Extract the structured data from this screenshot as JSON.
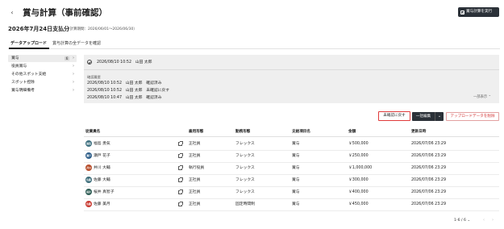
{
  "header": {
    "back_icon": "chevron-left-icon",
    "title": "賞与計算（事前確認）",
    "execute_button": "賞与計算を実行",
    "execute_icon": "checkbox-icon"
  },
  "payment": {
    "title": "2026年7月24日支払分",
    "period": "（計算期間：2026/06/01〜2026/06/30）"
  },
  "tabs": [
    {
      "label": "データアップロード",
      "active": true
    },
    {
      "label": "賞与計算の全データを確認",
      "active": false
    }
  ],
  "sidebar": {
    "items": [
      {
        "label": "賞与",
        "count": "6",
        "active": true
      },
      {
        "label": "役員賞与",
        "count": "",
        "active": false
      },
      {
        "label": "その他スポット支給",
        "count": "",
        "active": false
      },
      {
        "label": "スポット控除",
        "count": "",
        "active": false
      },
      {
        "label": "賞与明細備考",
        "count": "",
        "active": false
      }
    ]
  },
  "status": {
    "current": "2026/08/10 10:52　山田 太郎",
    "history_title": "確認履歴",
    "history": [
      "2026/08/10 10:52　山田 太郎　確認済み",
      "2026/08/10 10:52　山田 太郎　未確認に戻す",
      "2026/08/10 10:47　山田 太郎　確認済み"
    ],
    "collapse_label": "一部表示 ⌃"
  },
  "actions": {
    "unconfirm": "未確認に戻す",
    "bulk_edit": "一括編集",
    "delete_upload": "アップロードデータを削除"
  },
  "table": {
    "headers": [
      "従業員名",
      "雇用形態",
      "勤務形態",
      "支給項目名",
      "金額",
      "更新日時"
    ],
    "rows": [
      {
        "avatar": "福島",
        "avatar_color": "#3b6e7e",
        "name": "福島 勇気",
        "employment": "正社員",
        "work": "フレックス",
        "item": "賞与",
        "amount": "￥500,000",
        "updated": "2026/07/06 23:29"
      },
      {
        "avatar": "瀬戸",
        "avatar_color": "#2f5f8a",
        "name": "瀬戸 花子",
        "employment": "正社員",
        "work": "フレックス",
        "item": "賞与",
        "amount": "￥250,000",
        "updated": "2026/07/06 23:29"
      },
      {
        "avatar": "井川",
        "avatar_color": "#b8502e",
        "name": "井川 大輔",
        "employment": "執行役員",
        "work": "フレックス",
        "item": "賞与",
        "amount": "￥1,000,000",
        "updated": "2026/07/06 23:29"
      },
      {
        "avatar": "佐藤",
        "avatar_color": "#3a6b78",
        "name": "佐藤 大輔",
        "employment": "正社員",
        "work": "フレックス",
        "item": "賞与",
        "amount": "￥300,000",
        "updated": "2026/07/06 23:29"
      },
      {
        "avatar": "桜井",
        "avatar_color": "#2e5c54",
        "name": "桜井 真智子",
        "employment": "正社員",
        "work": "フレックス",
        "item": "賞与",
        "amount": "￥400,000",
        "updated": "2026/07/06 23:29"
      },
      {
        "avatar": "佐藤",
        "avatar_color": "#c9382f",
        "name": "佐藤 美月",
        "employment": "正社員",
        "work": "固定時間制",
        "item": "賞与",
        "amount": "￥450,000",
        "updated": "2026/07/06 23:29"
      }
    ]
  },
  "pagination": {
    "label": "1-6 / 6 ⌄",
    "prev_icon": "chevron-left-icon",
    "next_icon": "chevron-right-icon"
  }
}
